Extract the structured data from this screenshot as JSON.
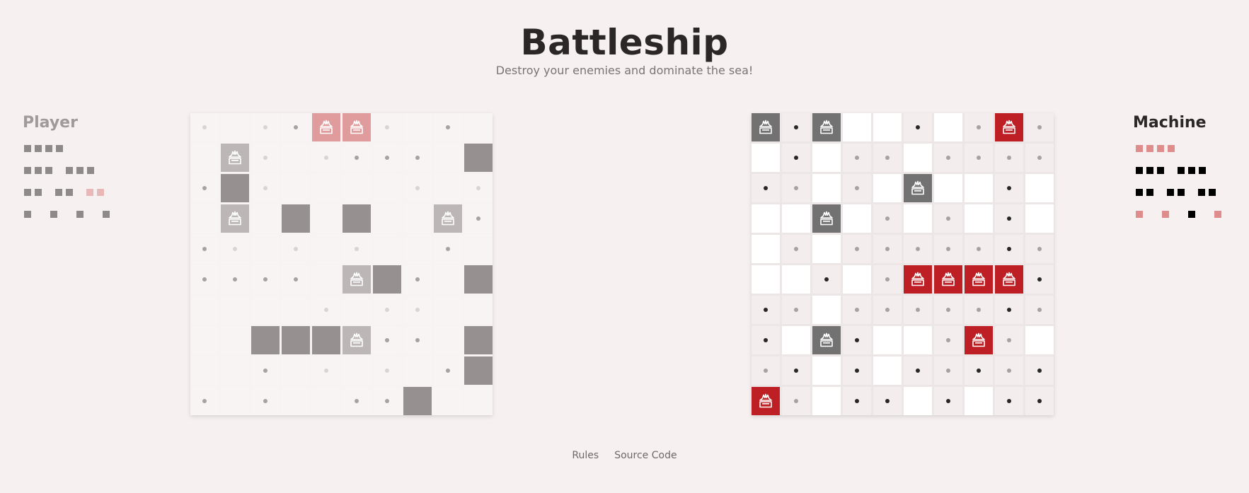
{
  "header": {
    "title": "Battleship",
    "subtitle": "Destroy your enemies and dominate the sea!"
  },
  "player": {
    "label": "Player",
    "fleet": [
      [
        [
          4,
          "intact"
        ]
      ],
      [
        [
          3,
          "intact"
        ],
        [
          3,
          "intact"
        ]
      ],
      [
        [
          2,
          "intact"
        ],
        [
          2,
          "intact"
        ],
        [
          2,
          "sunk"
        ]
      ],
      [
        [
          1,
          "intact"
        ],
        [
          1,
          "intact"
        ],
        [
          1,
          "intact"
        ],
        [
          1,
          "intact"
        ]
      ]
    ],
    "grid": [
      "l.lmSSl.m..",
      "._Hl.lmmm._S",
      "m_Sl....l.l",
      ".H.S.S..Hm",
      "ml.l.l..m.Sl",
      "mmmm.HSm.Sm",
      "....l.ll..",
      "..SSSHmm.S",
      "..m.l.l.mS",
      "m.m..mmS.."
    ]
  },
  "machine": {
    "label": "Machine",
    "fleet": [
      [
        [
          4,
          "sunk"
        ]
      ],
      [
        [
          3,
          "intact"
        ],
        [
          3,
          "intact"
        ]
      ],
      [
        [
          2,
          "intact"
        ],
        [
          2,
          "intact"
        ],
        [
          2,
          "intact"
        ]
      ],
      [
        [
          1,
          "sunk"
        ],
        [
          1,
          "sunk"
        ],
        [
          1,
          "intact"
        ],
        [
          1,
          "sunk"
        ]
      ]
    ],
    "grid": [
      "HdHOOdOmXm",
      "OdOmmOmmmm",
      "dmOmOHOOdO",
      "OOHOmOmOdO",
      "OmOmmmmmdm",
      "OOdOmXXXXd",
      "dmOmmmmmdm",
      "dOHdOOmXmO",
      "mdOdOdmdmd",
      "XmOddOdOdd"
    ]
  },
  "colors": {
    "background": "#f6f0f0",
    "sunk_red": "#bd1f24",
    "player_sunk_pink": "#e09c9c",
    "player_ship_gray": "#969090",
    "machine_hit_gray": "#727272",
    "fleet_intact_gray": "#8e8a8a",
    "fleet_sunk_pink": "#e8b7b7",
    "machine_fleet_intact": "#000000",
    "machine_fleet_sunk": "#df8c8c"
  },
  "icons": {
    "hit": "explosion-ship-icon",
    "miss": "dot"
  },
  "footer": {
    "rules": "Rules",
    "source": "Source Code"
  }
}
